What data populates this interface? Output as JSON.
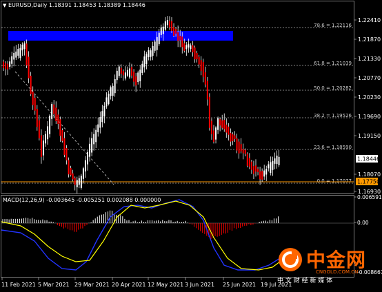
{
  "main_chart": {
    "header": "EURUSD,Daily  1.18391 1.18453 1.18389 1.18446",
    "price_ticks": [
      "1.22410",
      "1.21870",
      "1.21330",
      "1.20770",
      "1.20230",
      "1.19690",
      "1.19150",
      "1.18610",
      "1.18070",
      "1.17530",
      "1.16930"
    ],
    "current_price": "1.18446",
    "support_price": "1.17750",
    "fib_levels": [
      {
        "label": "78.6 = 1.22116"
      },
      {
        "label": "61.8 = 1.21039"
      },
      {
        "label": "50.0 = 1.20282"
      },
      {
        "label": "38.2 = 1.19526"
      },
      {
        "label": "23.6 = 1.18590"
      },
      {
        "label": "0.0 = 1.17077"
      }
    ],
    "resistance_zone_color": "#0000ff",
    "support_line_color": "#ff9900",
    "fib_line_color": "#808080",
    "bull_candle_color": "#ffffff",
    "bear_candle_color": "#ff0000"
  },
  "macd": {
    "header": "MACD(12,26,9) -0.003645 -0.005251 0.002088 0.000000",
    "axis_ticks": [
      "0.006591",
      "0.00",
      "-0.008667"
    ],
    "macd_line_color": "#0000ff",
    "signal_line_color": "#ffff00"
  },
  "date_axis": [
    "11 Feb 2021",
    "5 Mar 2021",
    "29 Mar 2021",
    "20 Apr 2021",
    "12 May 2021",
    "3 Jun 2021",
    "25 Jun 2021",
    "19 Jul 2021"
  ],
  "watermark": {
    "brand": "中金网",
    "site": "CNGOLD.COM.CN",
    "tagline": "中 文 财 经 新 媒 体",
    "brand_color": "#ff6600"
  }
}
